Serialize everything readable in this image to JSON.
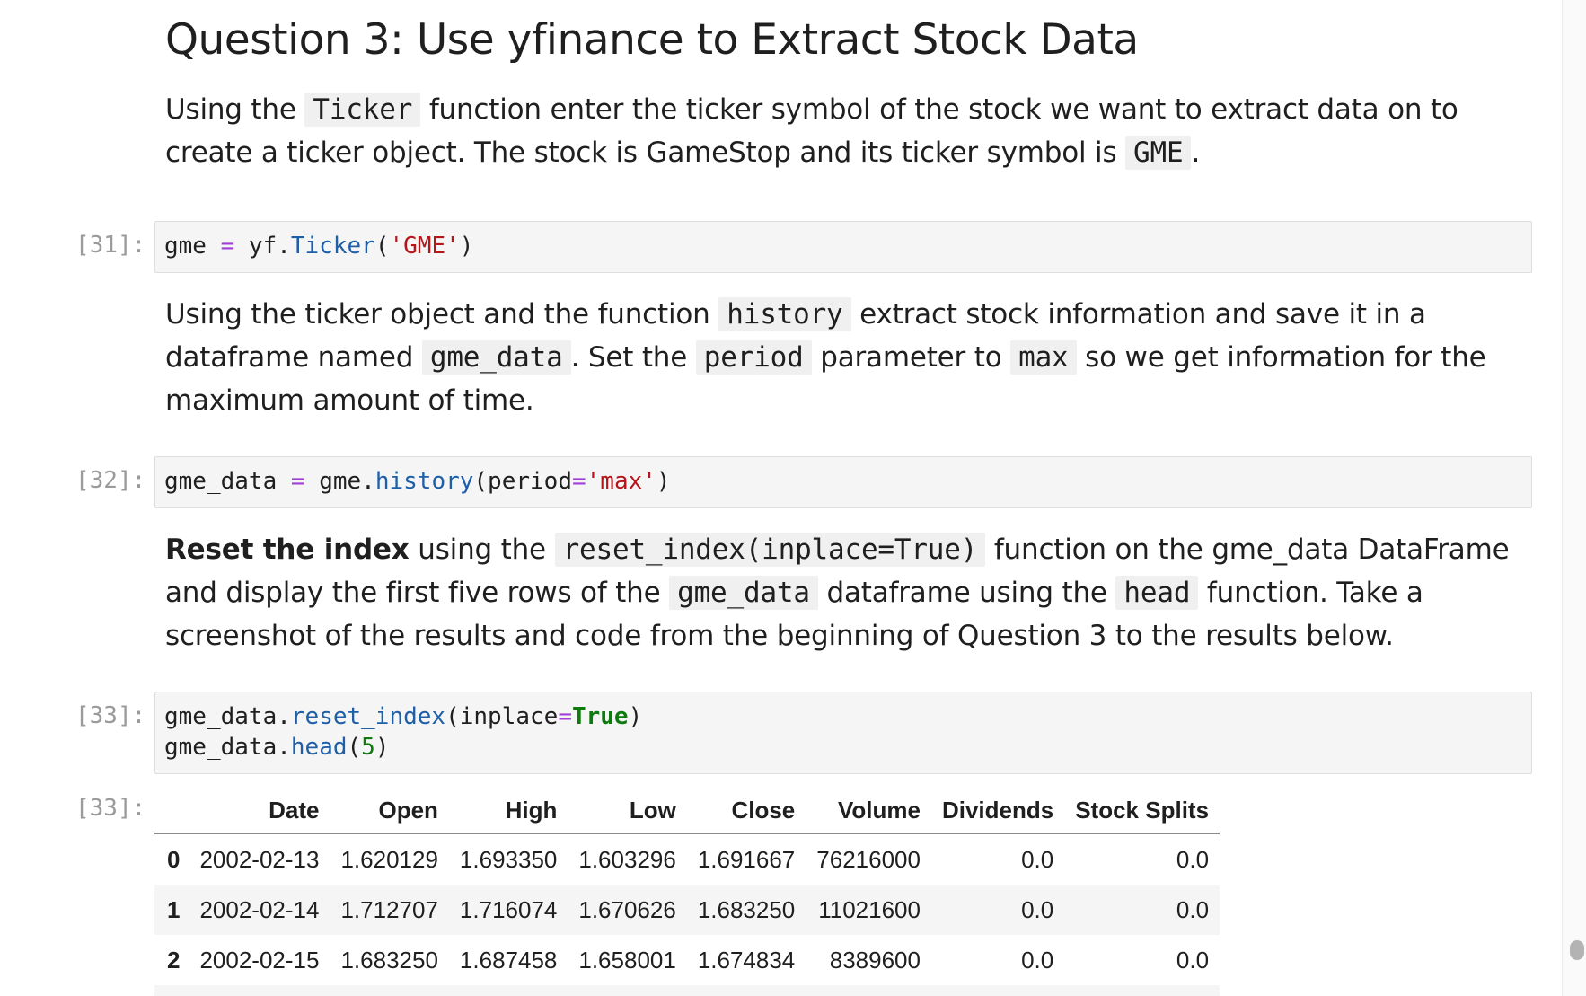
{
  "heading": "Question 3: Use yfinance to Extract Stock Data",
  "md1": {
    "t1": "Using the ",
    "c1": "Ticker",
    "t2": " function enter the ticker symbol of the stock we want to extract data on to create a ticker object. The stock is GameStop and its ticker symbol is ",
    "c2": "GME",
    "t3": "."
  },
  "cell31": {
    "prompt": "[31]:",
    "tokens": {
      "var": "gme ",
      "eq": "=",
      "obj": " yf.",
      "fn": "Ticker",
      "p1": "(",
      "s": "'GME'",
      "p2": ")"
    }
  },
  "md2": {
    "t1": "Using the ticker object and the function ",
    "c1": "history",
    "t2": " extract stock information and save it in a dataframe named ",
    "c2": "gme_data",
    "t3": ". Set the ",
    "c3": "period",
    "t4": " parameter to ",
    "c4": "max",
    "t5": " so we get information for the maximum amount of time."
  },
  "cell32": {
    "prompt": "[32]:",
    "tokens": {
      "var": "gme_data ",
      "eq": "=",
      "obj": " gme.",
      "fn": "history",
      "p1": "(period",
      "eq2": "=",
      "s": "'max'",
      "p2": ")"
    }
  },
  "md3": {
    "bold": "Reset the index",
    "t1": " using the ",
    "c1": "reset_index(inplace=True)",
    "t2": " function on the gme_data DataFrame and display the first five rows of the ",
    "c2": "gme_data",
    "t3": " dataframe using the ",
    "c3": "head",
    "t4": " function. Take a screenshot of the results and code from the beginning of Question 3 to the results below."
  },
  "cell33": {
    "prompt": "[33]:",
    "line1": {
      "obj": "gme_data.",
      "fn": "reset_index",
      "p1": "(inplace",
      "eq": "=",
      "kw": "True",
      "p2": ")"
    },
    "line2": {
      "obj": "gme_data.",
      "fn": "head",
      "p1": "(",
      "num": "5",
      "p2": ")"
    }
  },
  "output33": {
    "prompt": "[33]:",
    "columns": [
      "",
      "Date",
      "Open",
      "High",
      "Low",
      "Close",
      "Volume",
      "Dividends",
      "Stock Splits"
    ],
    "rows": [
      [
        "0",
        "2002-02-13",
        "1.620129",
        "1.693350",
        "1.603296",
        "1.691667",
        "76216000",
        "0.0",
        "0.0"
      ],
      [
        "1",
        "2002-02-14",
        "1.712707",
        "1.716074",
        "1.670626",
        "1.683250",
        "11021600",
        "0.0",
        "0.0"
      ],
      [
        "2",
        "2002-02-15",
        "1.683250",
        "1.687458",
        "1.658001",
        "1.674834",
        "8389600",
        "0.0",
        "0.0"
      ]
    ]
  },
  "colors": {
    "code_bg": "#f5f5f5",
    "prompt": "#9a9a9a",
    "operator": "#a23fd6",
    "string": "#b5161a",
    "function": "#1f5fa8",
    "keyword": "#0f7a0f"
  }
}
